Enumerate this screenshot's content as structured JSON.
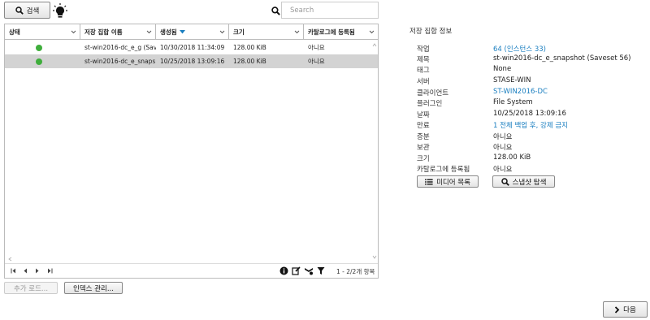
{
  "toolbar": {
    "search_button": "검색",
    "search_placeholder": "Search"
  },
  "grid": {
    "columns": [
      "상태",
      "저장 집합 이름",
      "생성됨",
      "크기",
      "카탈로그에 등록됨"
    ],
    "rows": [
      {
        "status_color": "#3fae3c",
        "name": "st-win2016-dc_e_g (Sav...",
        "created": "10/30/2018 11:34:09",
        "size": "128.00 KiB",
        "cataloged": "아니요"
      },
      {
        "status_color": "#3fae3c",
        "name": "st-win2016-dc_e_snaps...",
        "created": "10/25/2018 13:09:16",
        "size": "128.00 KiB",
        "cataloged": "아니요"
      }
    ],
    "count": "1 - 2/2개 항목"
  },
  "bottom": {
    "load_more": "추가 로드...",
    "manage_index": "인덱스 관리...",
    "next": "다음"
  },
  "info": {
    "title": "저장 집합 정보",
    "rows": [
      {
        "label": "작업",
        "value": "64 (인스턴스 33)",
        "link": true
      },
      {
        "label": "제목",
        "value": "st-win2016-dc_e_snapshot (Saveset 56)",
        "link": false
      },
      {
        "label": "태그",
        "value": "None",
        "link": false
      },
      {
        "label": "서버",
        "value": "STASE-WIN",
        "link": false
      },
      {
        "label": "클라이언트",
        "value": "ST-WIN2016-DC",
        "link": true
      },
      {
        "label": "플러그인",
        "value": "File System",
        "link": false
      },
      {
        "label": "날짜",
        "value": "10/25/2018 13:09:16",
        "link": false
      },
      {
        "label": "만료",
        "value": "1 전체 백업 후, 강제 금지",
        "link": true
      },
      {
        "label": "증분",
        "value": "아니요",
        "link": false
      },
      {
        "label": "보관",
        "value": "아니요",
        "link": false
      },
      {
        "label": "크기",
        "value": "128.00 KiB",
        "link": false
      },
      {
        "label": "카탈로그에 등록됨",
        "value": "아니요",
        "link": false
      }
    ],
    "media_button": "미디어 목록",
    "explore_button": "스냅샷 탐색"
  }
}
